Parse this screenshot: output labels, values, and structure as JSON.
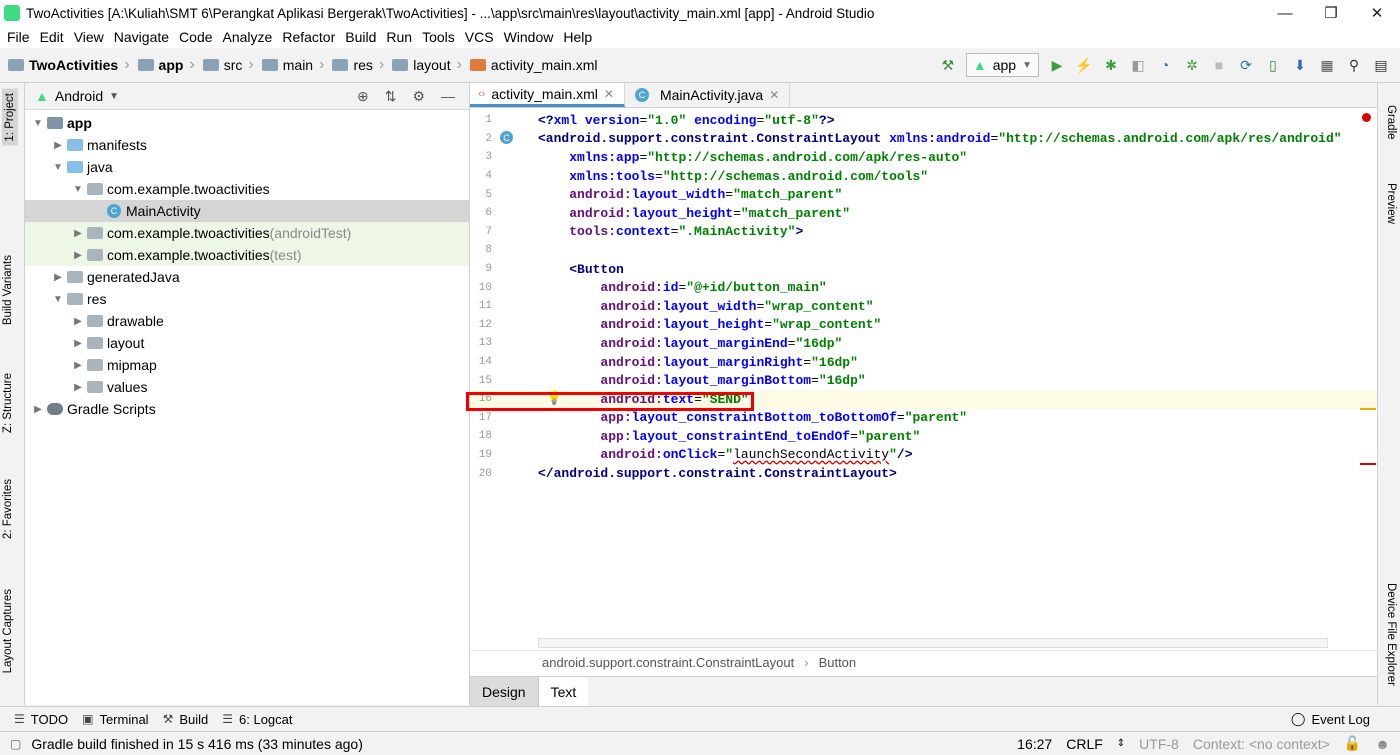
{
  "window": {
    "title": "TwoActivities [A:\\Kuliah\\SMT 6\\Perangkat Aplikasi Bergerak\\TwoActivities] - ...\\app\\src\\main\\res\\layout\\activity_main.xml [app] - Android Studio",
    "minimize": "—",
    "maximize": "❐",
    "close": "✕"
  },
  "menu": [
    "File",
    "Edit",
    "View",
    "Navigate",
    "Code",
    "Analyze",
    "Refactor",
    "Build",
    "Run",
    "Tools",
    "VCS",
    "Window",
    "Help"
  ],
  "breadcrumb": [
    "TwoActivities",
    "app",
    "src",
    "main",
    "res",
    "layout",
    "activity_main.xml"
  ],
  "toolbar": {
    "run_config": "app"
  },
  "left_tabs": [
    "1: Project",
    "Build Variants",
    "Z: Structure",
    "2: Favorites",
    "Layout Captures"
  ],
  "right_tabs": [
    "Gradle",
    "Preview",
    "Device File Explorer"
  ],
  "project": {
    "view": "Android",
    "tree": [
      {
        "label": "app",
        "suffix": "",
        "depth": 0,
        "arrow": "▼",
        "icon": "module",
        "bold": true
      },
      {
        "label": "manifests",
        "suffix": "",
        "depth": 1,
        "arrow": "▶",
        "icon": "folder-blue"
      },
      {
        "label": "java",
        "suffix": "",
        "depth": 1,
        "arrow": "▼",
        "icon": "folder-blue"
      },
      {
        "label": "com.example.twoactivities",
        "suffix": "",
        "depth": 2,
        "arrow": "▼",
        "icon": "package"
      },
      {
        "label": "MainActivity",
        "suffix": "",
        "depth": 3,
        "arrow": "",
        "icon": "class",
        "selected": true
      },
      {
        "label": "com.example.twoactivities",
        "suffix": " (androidTest)",
        "depth": 2,
        "arrow": "▶",
        "icon": "package",
        "test": true
      },
      {
        "label": "com.example.twoactivities",
        "suffix": " (test)",
        "depth": 2,
        "arrow": "▶",
        "icon": "package",
        "test": true
      },
      {
        "label": "generatedJava",
        "suffix": "",
        "depth": 1,
        "arrow": "▶",
        "icon": "folder-gen"
      },
      {
        "label": "res",
        "suffix": "",
        "depth": 1,
        "arrow": "▼",
        "icon": "folder-res"
      },
      {
        "label": "drawable",
        "suffix": "",
        "depth": 2,
        "arrow": "▶",
        "icon": "package"
      },
      {
        "label": "layout",
        "suffix": "",
        "depth": 2,
        "arrow": "▶",
        "icon": "package"
      },
      {
        "label": "mipmap",
        "suffix": "",
        "depth": 2,
        "arrow": "▶",
        "icon": "package"
      },
      {
        "label": "values",
        "suffix": "",
        "depth": 2,
        "arrow": "▶",
        "icon": "package"
      },
      {
        "label": "Gradle Scripts",
        "suffix": "",
        "depth": 0,
        "arrow": "▶",
        "icon": "gradle"
      }
    ]
  },
  "tabs": [
    {
      "label": "activity_main.xml",
      "active": true
    },
    {
      "label": "MainActivity.java",
      "active": false
    }
  ],
  "code": [
    [
      [
        "kw",
        "<?"
      ],
      [
        "at",
        "xml "
      ],
      [
        "at",
        "version"
      ],
      [
        "pl",
        "="
      ],
      [
        "st",
        "\"1.0\" "
      ],
      [
        "at",
        "encoding"
      ],
      [
        "pl",
        "="
      ],
      [
        "st",
        "\"utf-8\""
      ],
      [
        "kw",
        "?>"
      ]
    ],
    [
      [
        "kw",
        "<android.support.constraint.ConstraintLayout "
      ],
      [
        "at",
        "xmlns:android"
      ],
      [
        "pl",
        "="
      ],
      [
        "st",
        "\"http://schemas.android.com/apk/res/android\""
      ]
    ],
    [
      [
        "pl",
        "    "
      ],
      [
        "at",
        "xmlns:app"
      ],
      [
        "pl",
        "="
      ],
      [
        "st",
        "\"http://schemas.android.com/apk/res-auto\""
      ]
    ],
    [
      [
        "pl",
        "    "
      ],
      [
        "at",
        "xmlns:tools"
      ],
      [
        "pl",
        "="
      ],
      [
        "st",
        "\"http://schemas.android.com/tools\""
      ]
    ],
    [
      [
        "pl",
        "    "
      ],
      [
        "ns",
        "android:"
      ],
      [
        "at",
        "layout_width"
      ],
      [
        "pl",
        "="
      ],
      [
        "st",
        "\"match_parent\""
      ]
    ],
    [
      [
        "pl",
        "    "
      ],
      [
        "ns",
        "android:"
      ],
      [
        "at",
        "layout_height"
      ],
      [
        "pl",
        "="
      ],
      [
        "st",
        "\"match_parent\""
      ]
    ],
    [
      [
        "pl",
        "    "
      ],
      [
        "ns",
        "tools:"
      ],
      [
        "at",
        "context"
      ],
      [
        "pl",
        "="
      ],
      [
        "st",
        "\".MainActivity\""
      ],
      [
        "kw",
        ">"
      ]
    ],
    [],
    [
      [
        "pl",
        "    "
      ],
      [
        "kw",
        "<Button"
      ]
    ],
    [
      [
        "pl",
        "        "
      ],
      [
        "ns",
        "android:"
      ],
      [
        "at",
        "id"
      ],
      [
        "pl",
        "="
      ],
      [
        "st",
        "\"@+id/button_main\""
      ]
    ],
    [
      [
        "pl",
        "        "
      ],
      [
        "ns",
        "android:"
      ],
      [
        "at",
        "layout_width"
      ],
      [
        "pl",
        "="
      ],
      [
        "st",
        "\"wrap_content\""
      ]
    ],
    [
      [
        "pl",
        "        "
      ],
      [
        "ns",
        "android:"
      ],
      [
        "at",
        "layout_height"
      ],
      [
        "pl",
        "="
      ],
      [
        "st",
        "\"wrap_content\""
      ]
    ],
    [
      [
        "pl",
        "        "
      ],
      [
        "ns",
        "android:"
      ],
      [
        "at",
        "layout_marginEnd"
      ],
      [
        "pl",
        "="
      ],
      [
        "st",
        "\"16dp\""
      ]
    ],
    [
      [
        "pl",
        "        "
      ],
      [
        "ns",
        "android:"
      ],
      [
        "at",
        "layout_marginRight"
      ],
      [
        "pl",
        "="
      ],
      [
        "st",
        "\"16dp\""
      ]
    ],
    [
      [
        "pl",
        "        "
      ],
      [
        "ns",
        "android:"
      ],
      [
        "at",
        "layout_marginBottom"
      ],
      [
        "pl",
        "="
      ],
      [
        "st",
        "\"16dp\""
      ]
    ],
    [
      [
        "pl",
        "        "
      ],
      [
        "ns",
        "android:"
      ],
      [
        "at",
        "text"
      ],
      [
        "pl",
        "="
      ],
      [
        "st",
        "\"SEND\""
      ]
    ],
    [
      [
        "pl",
        "        "
      ],
      [
        "ns",
        "app:"
      ],
      [
        "at",
        "layout_constraintBottom_toBottomOf"
      ],
      [
        "pl",
        "="
      ],
      [
        "st",
        "\"parent\""
      ]
    ],
    [
      [
        "pl",
        "        "
      ],
      [
        "ns",
        "app:"
      ],
      [
        "at",
        "layout_constraintEnd_toEndOf"
      ],
      [
        "pl",
        "="
      ],
      [
        "st",
        "\"parent\""
      ]
    ],
    [
      [
        "pl",
        "        "
      ],
      [
        "ns",
        "android:"
      ],
      [
        "at",
        "onClick"
      ],
      [
        "pl",
        "="
      ],
      [
        "st",
        "\""
      ],
      [
        "warn",
        "launchSecondActivity"
      ],
      [
        "st",
        "\""
      ],
      [
        "kw",
        "/>"
      ]
    ],
    [
      [
        "kw",
        "</android.support.constraint.ConstraintLayout>"
      ]
    ]
  ],
  "current_line": 16,
  "editor_breadcrumb": [
    "android.support.constraint.ConstraintLayout",
    "Button"
  ],
  "design_tabs": {
    "design": "Design",
    "text": "Text"
  },
  "tool_windows": [
    {
      "label": "TODO",
      "glyph": "☰"
    },
    {
      "label": "Terminal",
      "glyph": "▣"
    },
    {
      "label": "Build",
      "glyph": "⚒"
    },
    {
      "label": "6: Logcat",
      "glyph": "☰"
    }
  ],
  "event_log": "Event Log",
  "status": {
    "message": "Gradle build finished in 15 s 416 ms (33 minutes ago)",
    "position": "16:27",
    "line_sep": "CRLF",
    "encoding": "UTF-8",
    "context": "Context: <no context>"
  }
}
